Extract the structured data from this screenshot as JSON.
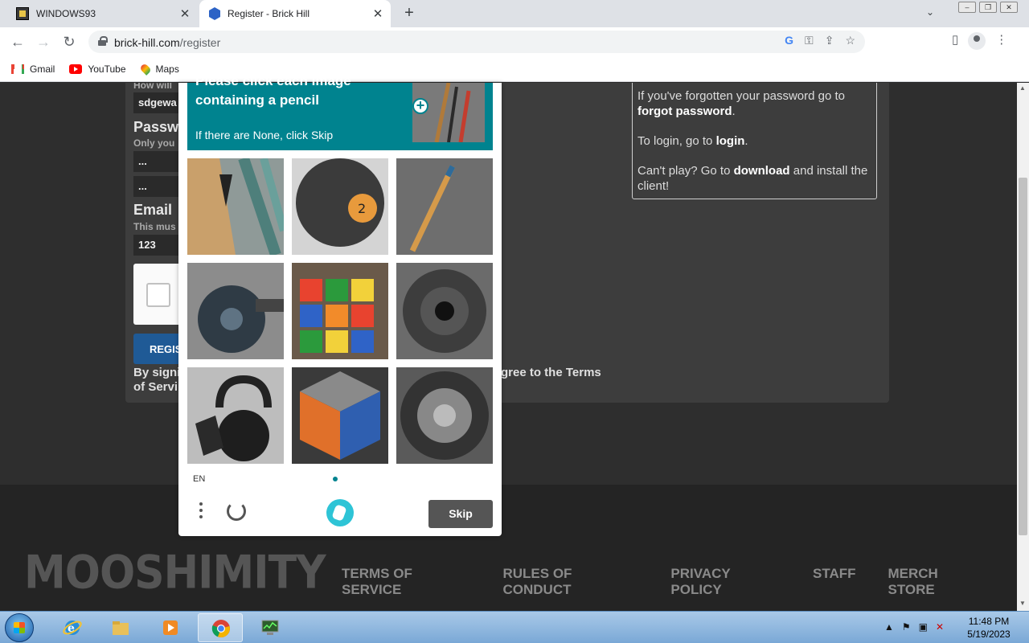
{
  "browser": {
    "tabs": [
      {
        "title": "WINDOWS93",
        "icon": "windows93-favicon-icon"
      },
      {
        "title": "Register - Brick Hill",
        "icon": "brickhill-favicon-icon"
      }
    ],
    "url_host": "brick-hill.com",
    "url_path": "/register",
    "bookmarks": [
      "Gmail",
      "YouTube",
      "Maps"
    ]
  },
  "form": {
    "username_hint": "How will",
    "username_value": "sdgewa",
    "password_label": "Passw",
    "password_hint": "Only you",
    "password_value": "...",
    "confirm_value": "...",
    "email_label": "Email",
    "email_hint": "This mus",
    "email_value": "123",
    "register_label": "REGIS",
    "agree_left_1": "By signi",
    "agree_left_2": "of Servi",
    "agree_right": "gree to the Terms"
  },
  "info": {
    "line1_pre": "If you've forgotten your password go to ",
    "line1_link": "forgot password",
    "line1_post": ".",
    "line2_pre": "To login, go to ",
    "line2_link": "login",
    "line2_post": ".",
    "line3_pre": "Can't play? Go to ",
    "line3_link": "download",
    "line3_post": " and install the client!"
  },
  "captcha": {
    "title_cut": "Please click each image",
    "title": "containing a pencil",
    "hint": "If there are None, click Skip",
    "language": "EN",
    "skip_label": "Skip",
    "tiles": [
      "pencils-bundle",
      "bowling-ball",
      "pencil-on-table",
      "dumbbell",
      "rubiks-cube",
      "wheel",
      "kettlebell",
      "rubiks-cube-2",
      "metal-wheel"
    ]
  },
  "footer": {
    "logo_text": "MOOSHIMITY",
    "links": [
      "TERMS OF SERVICE",
      "RULES OF CONDUCT",
      "PRIVACY POLICY",
      "STAFF",
      "MERCH STORE"
    ]
  },
  "taskbar": {
    "time": "11:48 PM",
    "date": "5/19/2023"
  },
  "colors": {
    "captcha_accent": "#00838f",
    "register_button": "#1f5a96"
  }
}
